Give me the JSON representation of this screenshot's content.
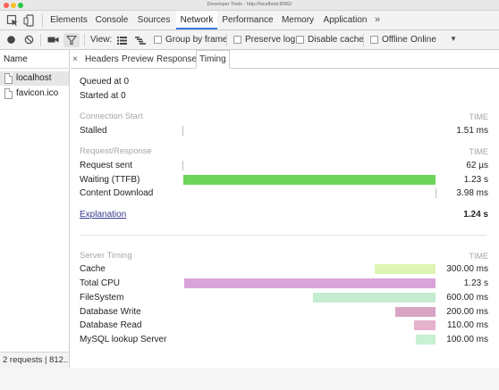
{
  "window": {
    "title": "Developer Tools - http://localhost:8082/"
  },
  "panel_tabs": [
    {
      "label": "Elements"
    },
    {
      "label": "Console"
    },
    {
      "label": "Sources"
    },
    {
      "label": "Network"
    },
    {
      "label": "Performance"
    },
    {
      "label": "Memory"
    },
    {
      "label": "Application"
    }
  ],
  "panel_tabs_overflow": "»",
  "toolbar": {
    "view_label": "View:",
    "group_by_frame": "Group by frame",
    "preserve_log": "Preserve log",
    "disable_cache": "Disable cache",
    "offline": "Offline",
    "throttle_value": "Online"
  },
  "requests": {
    "header": "Name",
    "items": [
      {
        "name": "localhost",
        "selected": true
      },
      {
        "name": "favicon.ico",
        "selected": false
      }
    ],
    "summary": "2 requests | 812..."
  },
  "detail_tabs": {
    "close": "×",
    "tabs": [
      {
        "label": "Headers"
      },
      {
        "label": "Preview"
      },
      {
        "label": "Response"
      },
      {
        "label": "Timing"
      }
    ]
  },
  "timing": {
    "queued": "Queued at 0",
    "started": "Started at 0",
    "time_label": "TIME",
    "connection_start": {
      "heading": "Connection Start",
      "rows": [
        {
          "label": "Stalled",
          "value": "1.51 ms"
        }
      ]
    },
    "request_response": {
      "heading": "Request/Response",
      "rows": [
        {
          "label": "Request sent",
          "value": "62 µs"
        },
        {
          "label": "Waiting (TTFB)",
          "value": "1.23 s"
        },
        {
          "label": "Content Download",
          "value": "3.98 ms"
        }
      ]
    },
    "explanation": "Explanation",
    "total": "1.24 s",
    "server_timing": {
      "heading": "Server Timing",
      "rows": [
        {
          "label": "Cache",
          "value": "300.00 ms"
        },
        {
          "label": "Total CPU",
          "value": "1.23 s"
        },
        {
          "label": "FileSystem",
          "value": "600.00 ms"
        },
        {
          "label": "Database Write",
          "value": "200.00 ms"
        },
        {
          "label": "Database Read",
          "value": "110.00 ms"
        },
        {
          "label": "MySQL lookup Server",
          "value": "100.00 ms"
        }
      ]
    }
  },
  "colors": {
    "waiting": "#6fd45a",
    "cache": "#ddf5b4",
    "total_cpu": "#d9a4d9",
    "filesystem": "#c3ecd0",
    "db_write": "#d9a4c4",
    "db_read": "#e5b2cc",
    "mysql": "#c8f0d4",
    "active_tab_underline": "#3879d9"
  }
}
